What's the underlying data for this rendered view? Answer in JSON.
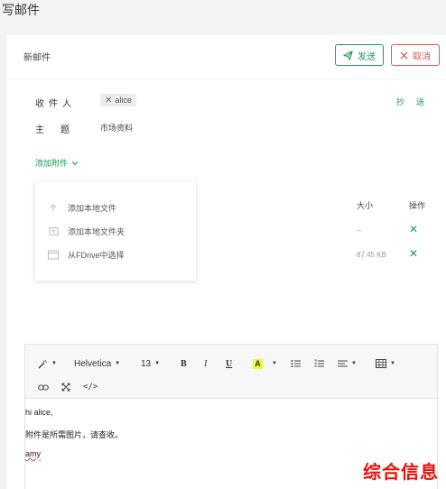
{
  "page_title": "写邮件",
  "card": {
    "title": "新邮件",
    "send_label": "发送",
    "cancel_label": "取消"
  },
  "form": {
    "to_label": "收件人",
    "recipient": "alice",
    "cc_link": "抄",
    "bcc_link": "送",
    "subject_label": "主题",
    "subject_value": "市场资料"
  },
  "attachments": {
    "toggle_label": "添加附件",
    "size_header": "大小",
    "action_header": "操作",
    "rows": [
      {
        "size": "--"
      },
      {
        "size": "87.45 KB"
      }
    ]
  },
  "dropdown": {
    "items": [
      {
        "label": "添加本地文件",
        "icon": "upload-icon"
      },
      {
        "label": "添加本地文件夹",
        "icon": "folder-upload-icon"
      },
      {
        "label": "从FDrive中选择",
        "icon": "window-icon"
      }
    ]
  },
  "editor": {
    "font_family": "Helvetica",
    "font_size": "13",
    "bold": "B",
    "italic": "I",
    "underline": "U",
    "highlight": "A",
    "highlight_color": "#e8ff3a",
    "content": [
      "hi alice,",
      "附件是所需图片，请查收。",
      "amy"
    ]
  },
  "watermark": "综合信息",
  "colors": {
    "accent": "#1f9a5a",
    "danger": "#e05555",
    "watermark": "#e8120c"
  }
}
